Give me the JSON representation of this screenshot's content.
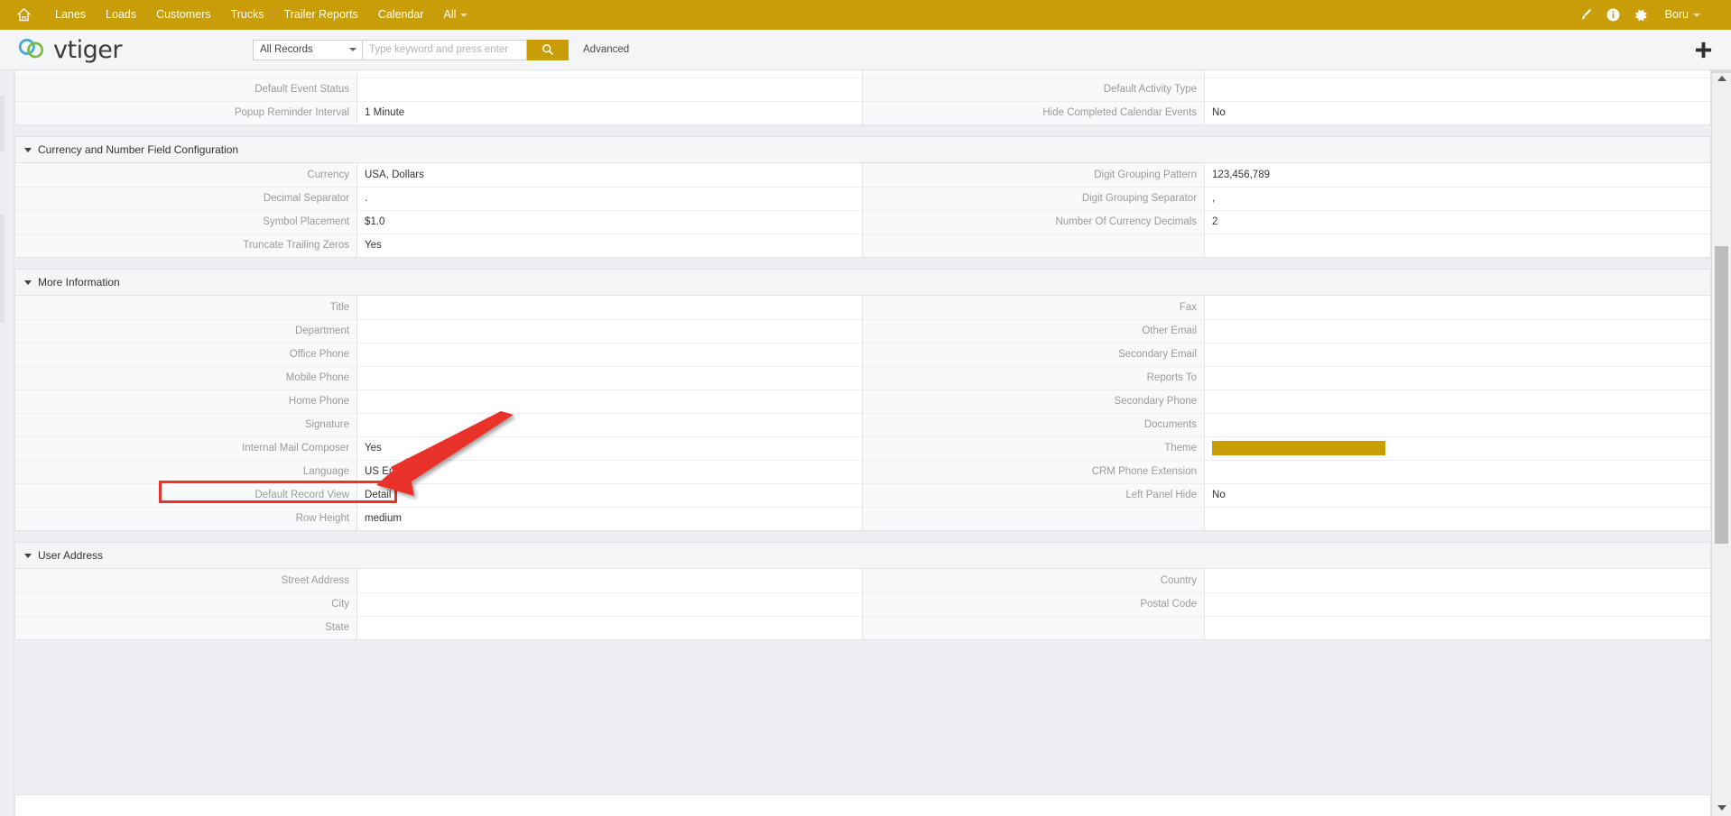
{
  "topnav": {
    "home_icon": "home-icon",
    "items": [
      {
        "label": "Lanes"
      },
      {
        "label": "Loads"
      },
      {
        "label": "Customers"
      },
      {
        "label": "Trucks"
      },
      {
        "label": "Trailer Reports"
      },
      {
        "label": "Calendar"
      },
      {
        "label": "All",
        "has_caret": true
      }
    ],
    "right_icons": [
      {
        "name": "paintbrush-icon"
      },
      {
        "name": "info-icon"
      },
      {
        "name": "gear-icon"
      }
    ],
    "user_label": "Boru"
  },
  "searchbar": {
    "logo_text": "vtiger",
    "record_scope": "All Records",
    "search_placeholder": "Type keyword and press enter",
    "search_value": "",
    "search_button_icon": "search-icon",
    "advanced_label": "Advanced",
    "add_button_icon": "plus-icon"
  },
  "colors": {
    "brand_gold": "#c99d07",
    "annotation_red": "#e8332a",
    "theme_swatch": "#c99d07"
  },
  "blocks": [
    {
      "id": "calendar-settings",
      "title": "",
      "show_header": false,
      "rows": [
        {
          "left_label": "",
          "left_value": "",
          "right_label": "",
          "right_value": ""
        },
        {
          "left_label": "Default Event Status",
          "left_value": "",
          "right_label": "Default Activity Type",
          "right_value": ""
        },
        {
          "left_label": "Popup Reminder Interval",
          "left_value": "1 Minute",
          "right_label": "Hide Completed Calendar Events",
          "right_value": "No"
        }
      ]
    },
    {
      "id": "currency-config",
      "title": "Currency and Number Field Configuration",
      "show_header": true,
      "rows": [
        {
          "left_label": "Currency",
          "left_value": "USA, Dollars",
          "right_label": "Digit Grouping Pattern",
          "right_value": "123,456,789"
        },
        {
          "left_label": "Decimal Separator",
          "left_value": ".",
          "right_label": "Digit Grouping Separator",
          "right_value": ","
        },
        {
          "left_label": "Symbol Placement",
          "left_value": "$1.0",
          "right_label": "Number Of Currency Decimals",
          "right_value": "2"
        },
        {
          "left_label": "Truncate Trailing Zeros",
          "left_value": "Yes",
          "right_label": "",
          "right_value": ""
        }
      ]
    },
    {
      "id": "more-information",
      "title": "More Information",
      "show_header": true,
      "rows": [
        {
          "left_label": "Title",
          "left_value": "",
          "right_label": "Fax",
          "right_value": ""
        },
        {
          "left_label": "Department",
          "left_value": "",
          "right_label": "Other Email",
          "right_value": ""
        },
        {
          "left_label": "Office Phone",
          "left_value": "",
          "right_label": "Secondary Email",
          "right_value": ""
        },
        {
          "left_label": "Mobile Phone",
          "left_value": "",
          "right_label": "Reports To",
          "right_value": ""
        },
        {
          "left_label": "Home Phone",
          "left_value": "",
          "right_label": "Secondary Phone",
          "right_value": ""
        },
        {
          "left_label": "Signature",
          "left_value": "",
          "right_label": "Documents",
          "right_value": ""
        },
        {
          "left_label": "Internal Mail Composer",
          "left_value": "Yes",
          "right_label": "Theme",
          "right_value": "",
          "right_is_swatch": true
        },
        {
          "left_label": "Language",
          "left_value": "US English",
          "right_label": "CRM Phone Extension",
          "right_value": ""
        },
        {
          "left_label": "Default Record View",
          "left_value": "Detail",
          "right_label": "Left Panel Hide",
          "right_value": "No",
          "highlighted": true
        },
        {
          "left_label": "Row Height",
          "left_value": "medium",
          "right_label": "",
          "right_value": ""
        }
      ]
    },
    {
      "id": "user-address",
      "title": "User Address",
      "show_header": true,
      "rows": [
        {
          "left_label": "Street Address",
          "left_value": "",
          "right_label": "Country",
          "right_value": ""
        },
        {
          "left_label": "City",
          "left_value": "",
          "right_label": "Postal Code",
          "right_value": ""
        },
        {
          "left_label": "State",
          "left_value": "",
          "right_label": "",
          "right_value": ""
        }
      ]
    }
  ],
  "annotation": {
    "shape": "arrow",
    "target_row_label": "Default Record View",
    "target_row_value": "Detail"
  },
  "scrollbar": {
    "orientation": "vertical",
    "up_arrow": "caret-up-icon",
    "down_arrow": "caret-down-icon"
  }
}
